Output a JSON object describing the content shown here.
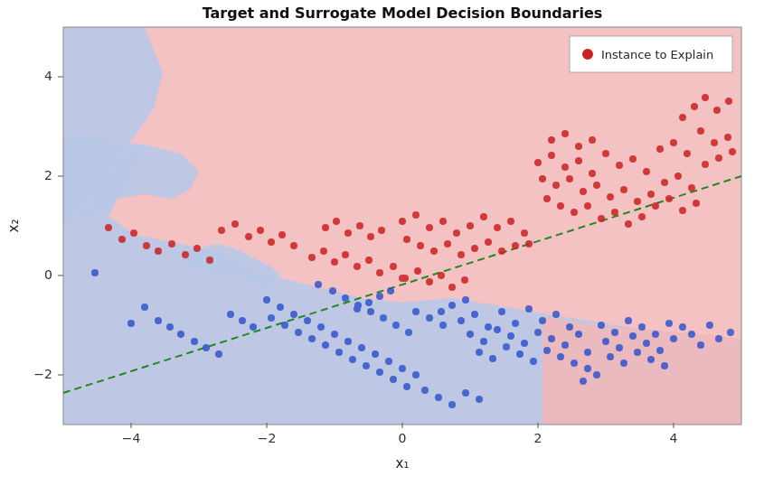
{
  "chart": {
    "title": "Target and Surrogate Model Decision Boundaries",
    "x_label": "x₁",
    "y_label": "x₂",
    "legend": {
      "instance_label": "Instance to Explain"
    },
    "x_ticks": [
      "-4",
      "-2",
      "0",
      "2",
      "4"
    ],
    "y_ticks": [
      "-2",
      "0",
      "2",
      "4"
    ],
    "colors": {
      "red_region": "#f4b8b8",
      "blue_region": "#b8c8e8",
      "red_dot": "#cc2222",
      "blue_dot": "#3355aa",
      "dashed_line": "#228822",
      "instance_dot": "#dd0000"
    }
  }
}
